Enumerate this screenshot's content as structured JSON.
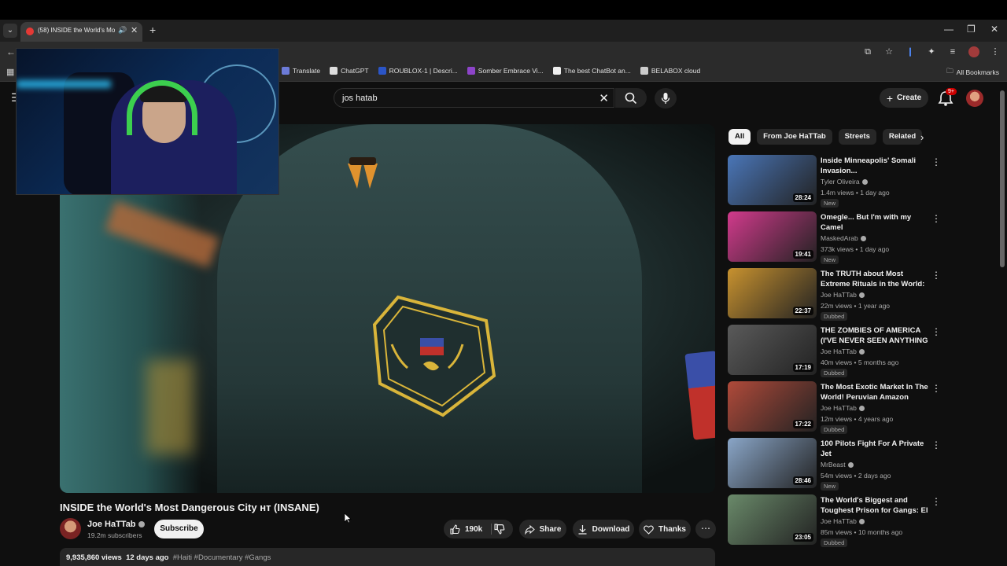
{
  "browser": {
    "tab_title": "(58) INSIDE the World's Mo",
    "bookmarks": [
      {
        "label": "Translate",
        "color": "#6c7bd8"
      },
      {
        "label": "ChatGPT",
        "color": "#dddddd"
      },
      {
        "label": "ROUBLOX-1 | Descri...",
        "color": "#2b55c7"
      },
      {
        "label": "Somber Embrace Vi...",
        "color": "#8d44c9"
      },
      {
        "label": "The best ChatBot an...",
        "color": "#eeeeee"
      },
      {
        "label": "BELABOX cloud",
        "color": "#cccccc"
      }
    ],
    "all_bookmarks": "All Bookmarks"
  },
  "youtube": {
    "search_value": "jos hatab",
    "create_label": "Create",
    "notification_count": "9+"
  },
  "video": {
    "title": "INSIDE the World's Most Dangerous City ʜᴛ (INSANE)",
    "channel": "Joe HaTTab",
    "subscribers": "19.2m subscribers",
    "subscribe_label": "Subscribe",
    "likes": "190k",
    "share_label": "Share",
    "download_label": "Download",
    "thanks_label": "Thanks",
    "views": "9,935,860 views",
    "age": "12 days ago",
    "tags": "#Haiti #Documentary #Gangs"
  },
  "chips": [
    "All",
    "From Joe HaTTab",
    "Streets",
    "Related"
  ],
  "recommendations": [
    {
      "title": "Inside Minneapolis' Somali Invasion...",
      "channel": "Tyler Oliveira",
      "meta": "1.4m views • 1 day ago",
      "badge": "New",
      "duration": "28:24"
    },
    {
      "title": "Omegle... But I'm with my Camel",
      "channel": "MaskedArab",
      "meta": "373k views • 1 day ago",
      "badge": "New",
      "duration": "19:41"
    },
    {
      "title": "The TRUTH about Most Extreme Rituals in the World: Voodoo | ...",
      "channel": "Joe HaTTab",
      "meta": "22m views • 1 year ago",
      "badge": "Dubbed",
      "duration": "22:37"
    },
    {
      "title": "THE ZOMBIES OF AMERICA (I'VE NEVER SEEN ANYTHING ...",
      "channel": "Joe HaTTab",
      "meta": "40m views • 5 months ago",
      "badge": "Dubbed",
      "duration": "17:19"
    },
    {
      "title": "The Most Exotic Market In The World! Peruvian Amazon",
      "channel": "Joe HaTTab",
      "meta": "12m views • 4 years ago",
      "badge": "Dubbed",
      "duration": "17:22"
    },
    {
      "title": "100 Pilots Fight For A Private Jet",
      "channel": "MrBeast",
      "meta": "54m views • 2 days ago",
      "badge": "New",
      "duration": "28:46"
    },
    {
      "title": "The World's Biggest and Toughest Prison for Gangs: El ...",
      "channel": "Joe HaTTab",
      "meta": "85m views • 10 months ago",
      "badge": "Dubbed",
      "duration": "23:05"
    }
  ],
  "thumb_colors": [
    "#4a76b8",
    "#d23a8c",
    "#c8922f",
    "#5a5a5a",
    "#b04a3a",
    "#8aa6c8",
    "#6a8a6a"
  ]
}
